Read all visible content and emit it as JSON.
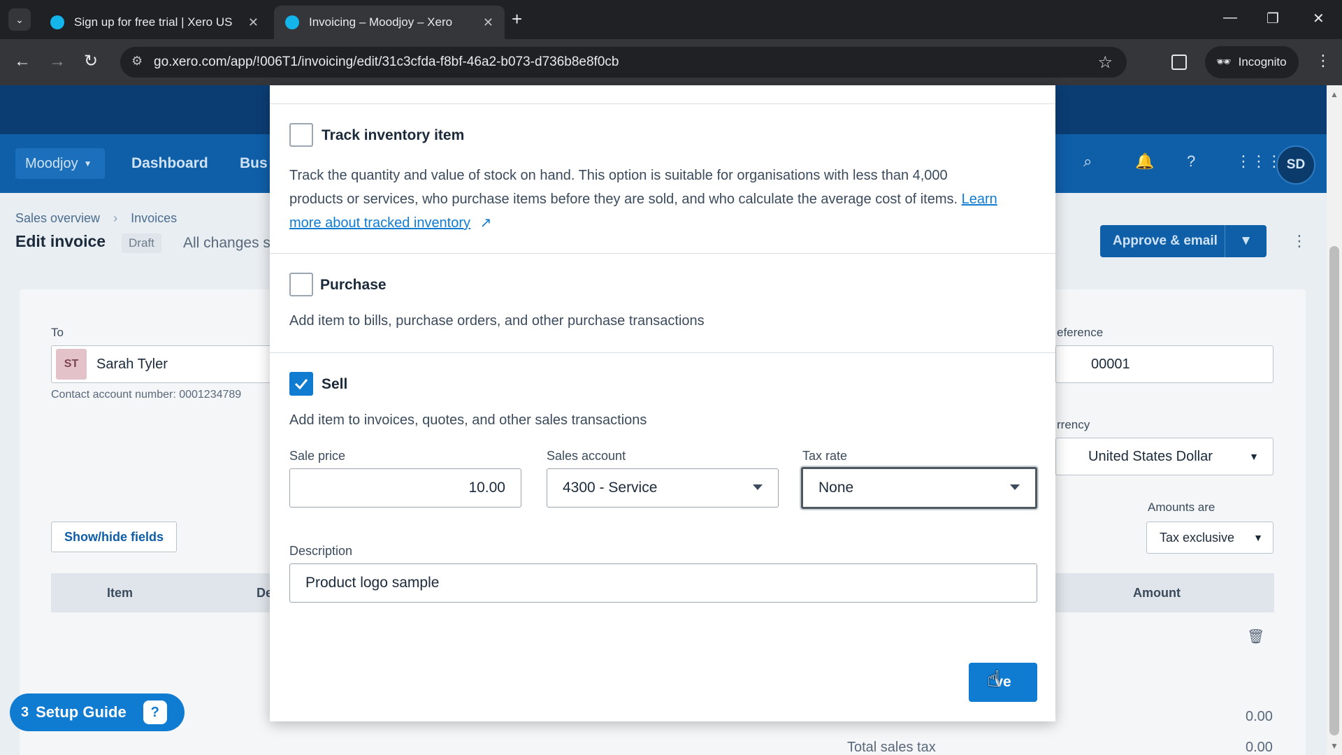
{
  "browser": {
    "tabs": [
      {
        "title": "Sign up for free trial | Xero US"
      },
      {
        "title": "Invoicing – Moodjoy – Xero"
      }
    ],
    "url": "go.xero.com/app/!006T1/invoicing/edit/31c3cfda-f8bf-46a2-b073-d736b8e8f0cb",
    "incognito_label": "Incognito"
  },
  "xero": {
    "org_name": "Moodjoy",
    "nav": [
      "Dashboard",
      "Bus"
    ],
    "avatar": "SD",
    "breadcrumbs": [
      "Sales overview",
      "Invoices"
    ],
    "page_title": "Edit invoice",
    "status_badge": "Draft",
    "save_status": "All changes s",
    "approve_button": "Approve & email",
    "to_label": "To",
    "contact_initials": "ST",
    "contact_name": "Sarah Tyler",
    "contact_account": "Contact account number: 0001234789",
    "reference_label": "eference",
    "reference_value": "00001",
    "currency_label": "rrency",
    "currency_value": "United States Dollar",
    "amounts_are_label": "Amounts are",
    "amounts_are_value": "Tax exclusive",
    "show_hide_button": "Show/hide fields",
    "table_headers": {
      "item": "Item",
      "description_partial": "De",
      "amount": "Amount"
    },
    "subtotal_value": "0.00",
    "total_sales_tax_label": "Total sales tax",
    "total_sales_tax_value": "0.00",
    "setup_guide": {
      "count": "3",
      "label": "Setup Guide"
    }
  },
  "modal": {
    "track_inventory": {
      "label": "Track inventory item",
      "checked": false,
      "description_line1": "Track the quantity and value of stock on hand. This option is suitable for organisations with less than 4,000",
      "description_line2": "products or services, who purchase items before they are sold, and who calculate the average cost of items.",
      "link_part1": "Learn",
      "link_part2": "more about tracked inventory"
    },
    "purchase": {
      "label": "Purchase",
      "checked": false,
      "description": "Add item to bills, purchase orders, and other purchase transactions"
    },
    "sell": {
      "label": "Sell",
      "checked": true,
      "description": "Add item to invoices, quotes, and other sales transactions",
      "sale_price_label": "Sale price",
      "sale_price_value": "10.00",
      "sales_account_label": "Sales account",
      "sales_account_value": "4300 - Service",
      "tax_rate_label": "Tax rate",
      "tax_rate_value": "None",
      "description_label": "Description",
      "description_value": "Product logo sample"
    },
    "save_button": "ve"
  }
}
